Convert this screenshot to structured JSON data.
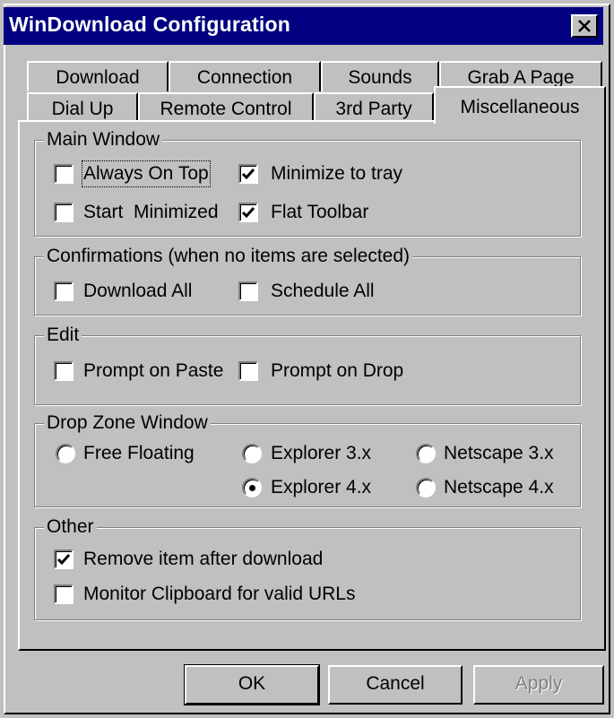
{
  "window": {
    "title": "WinDownload Configuration"
  },
  "tabs_back": [
    "Download",
    "Connection",
    "Sounds",
    "Grab A Page"
  ],
  "tabs_front": [
    "Dial Up",
    "Remote Control",
    "3rd Party",
    "Miscellaneous"
  ],
  "active_tab": "Miscellaneous",
  "groups": {
    "main_window": {
      "legend": "Main Window",
      "always_on_top": {
        "label": "Always On Top",
        "checked": false
      },
      "minimize_to_tray": {
        "label": "Minimize to tray",
        "checked": true
      },
      "start_minimized": {
        "label": "Start  Minimized",
        "checked": false
      },
      "flat_toolbar": {
        "label": "Flat Toolbar",
        "checked": true
      }
    },
    "confirmations": {
      "legend": "Confirmations (when no items are selected)",
      "download_all": {
        "label": "Download All",
        "checked": false
      },
      "schedule_all": {
        "label": "Schedule All",
        "checked": false
      }
    },
    "edit": {
      "legend": "Edit",
      "prompt_on_paste": {
        "label": "Prompt on Paste",
        "checked": false
      },
      "prompt_on_drop": {
        "label": "Prompt on Drop",
        "checked": false
      }
    },
    "drop_zone": {
      "legend": "Drop Zone Window",
      "options": [
        "Free Floating",
        "Explorer 3.x",
        "Netscape 3.x",
        "Explorer 4.x",
        "Netscape 4.x"
      ],
      "selected": "Explorer 4.x"
    },
    "other": {
      "legend": "Other",
      "remove_item": {
        "label": "Remove item after download",
        "checked": true
      },
      "monitor_clipboard": {
        "label": "Monitor Clipboard for valid URLs",
        "checked": false
      }
    }
  },
  "buttons": {
    "ok": "OK",
    "cancel": "Cancel",
    "apply": "Apply"
  }
}
